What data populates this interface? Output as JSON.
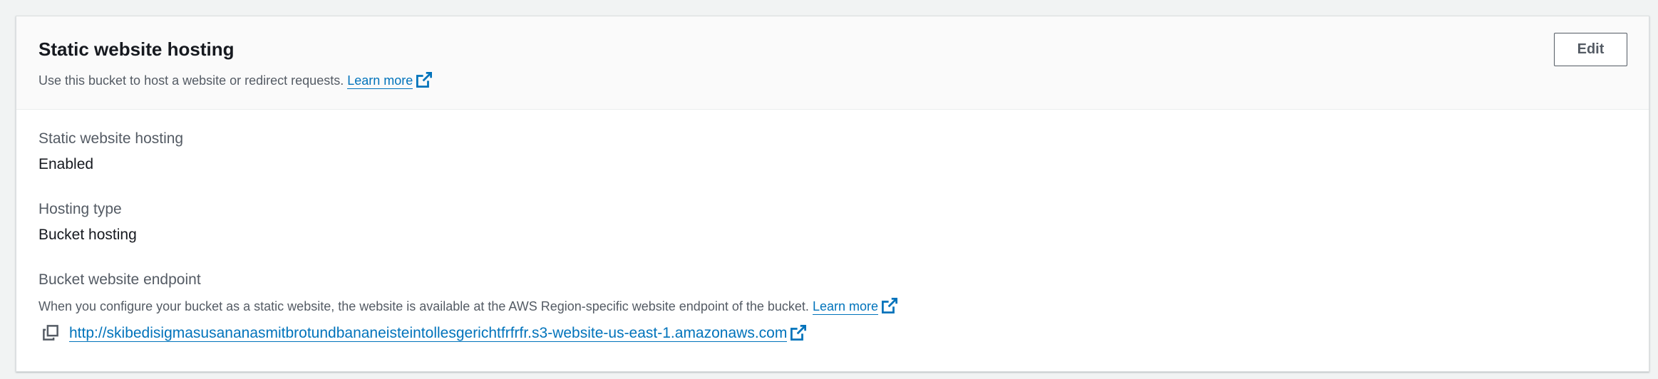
{
  "header": {
    "title": "Static website hosting",
    "description": "Use this bucket to host a website or redirect requests.",
    "learn_more": "Learn more",
    "edit_label": "Edit"
  },
  "fields": {
    "hosting": {
      "label": "Static website hosting",
      "value": "Enabled"
    },
    "type": {
      "label": "Hosting type",
      "value": "Bucket hosting"
    },
    "endpoint": {
      "label": "Bucket website endpoint",
      "description": "When you configure your bucket as a static website, the website is available at the AWS Region-specific website endpoint of the bucket.",
      "learn_more": "Learn more",
      "url": "http://skibedisigmasusananasmitbrotundbananeisteintollesgerichtfrfrfr.s3-website-us-east-1.amazonaws.com"
    }
  },
  "icons": {
    "external_link": "external-link-icon",
    "copy": "copy-icon"
  },
  "colors": {
    "link": "#0073bb",
    "label": "#545b64",
    "text": "#16191f",
    "header_bg": "#fafafa",
    "page_bg": "#f1f3f3"
  }
}
